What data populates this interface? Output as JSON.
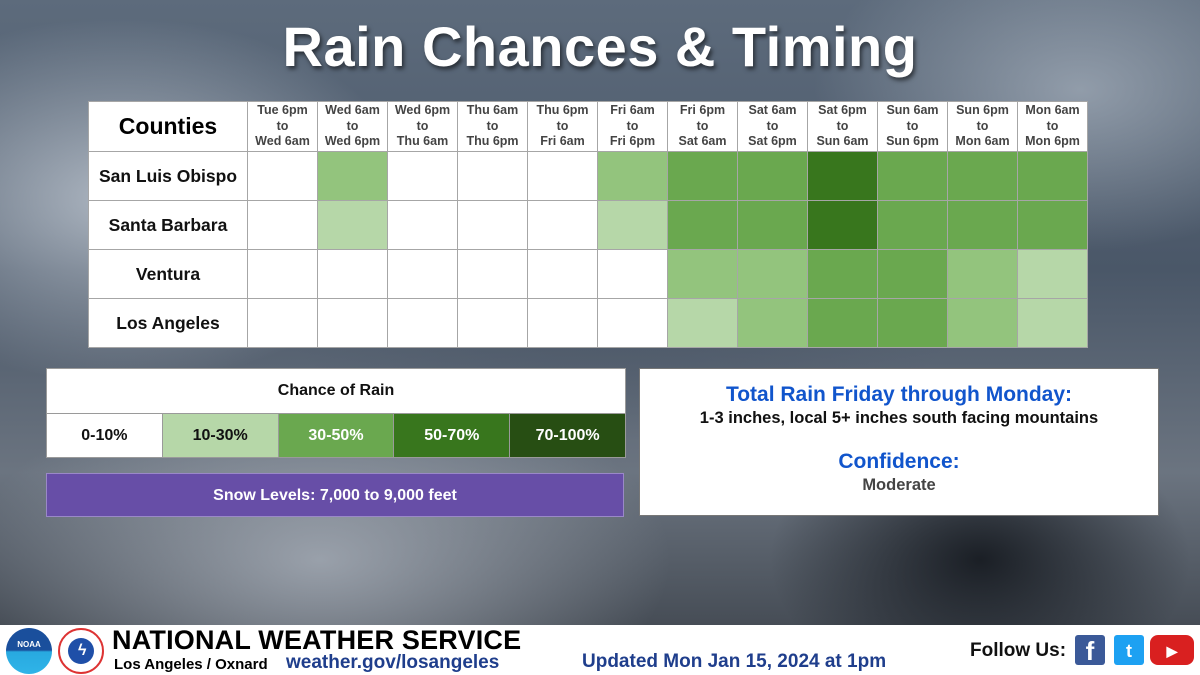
{
  "title": "Rain Chances & Timing",
  "grid": {
    "corner_label": "Counties",
    "periods": [
      {
        "l1": "Tue 6pm",
        "l2": "to",
        "l3": "Wed 6am"
      },
      {
        "l1": "Wed 6am",
        "l2": "to",
        "l3": "Wed 6pm"
      },
      {
        "l1": "Wed 6pm",
        "l2": "to",
        "l3": "Thu 6am"
      },
      {
        "l1": "Thu 6am",
        "l2": "to",
        "l3": "Thu 6pm"
      },
      {
        "l1": "Thu 6pm",
        "l2": "to",
        "l3": "Fri 6am"
      },
      {
        "l1": "Fri 6am",
        "l2": "to",
        "l3": "Fri 6pm"
      },
      {
        "l1": "Fri 6pm",
        "l2": "to",
        "l3": "Sat 6am"
      },
      {
        "l1": "Sat 6am",
        "l2": "to",
        "l3": "Sat 6pm"
      },
      {
        "l1": "Sat 6pm",
        "l2": "to",
        "l3": "Sun 6am"
      },
      {
        "l1": "Sun 6am",
        "l2": "to",
        "l3": "Sun 6pm"
      },
      {
        "l1": "Sun 6pm",
        "l2": "to",
        "l3": "Mon 6am"
      },
      {
        "l1": "Mon 6am",
        "l2": "to",
        "l3": "Mon 6pm"
      }
    ],
    "level_colors": [
      "#ffffff",
      "#b6d7a8",
      "#93c47d",
      "#6aa84f",
      "#38761d"
    ],
    "rows": [
      {
        "county": "San Luis Obispo",
        "levels": [
          0,
          2,
          0,
          0,
          0,
          2,
          3,
          3,
          4,
          3,
          3,
          3
        ]
      },
      {
        "county": "Santa Barbara",
        "levels": [
          0,
          1,
          0,
          0,
          0,
          1,
          3,
          3,
          4,
          3,
          3,
          3
        ]
      },
      {
        "county": "Ventura",
        "levels": [
          0,
          0,
          0,
          0,
          0,
          0,
          2,
          2,
          3,
          3,
          2,
          1
        ]
      },
      {
        "county": "Los Angeles",
        "levels": [
          0,
          0,
          0,
          0,
          0,
          0,
          1,
          2,
          3,
          3,
          2,
          1
        ]
      }
    ]
  },
  "legend": {
    "title": "Chance of Rain",
    "items": [
      {
        "label": "0-10%",
        "color": "#ffffff",
        "text_color": "#111111"
      },
      {
        "label": "10-30%",
        "color": "#b6d7a8",
        "text_color": "#111111"
      },
      {
        "label": "30-50%",
        "color": "#6aa84f",
        "text_color": "#ffffff"
      },
      {
        "label": "50-70%",
        "color": "#38761d",
        "text_color": "#ffffff"
      },
      {
        "label": "70-100%",
        "color": "#274e13",
        "text_color": "#ffffff"
      }
    ]
  },
  "snow_levels": "Snow Levels: 7,000 to 9,000 feet",
  "info": {
    "total_heading": "Total Rain Friday through Monday:",
    "total_value": "1-3 inches, local 5+ inches south facing mountains",
    "confidence_heading": "Confidence:",
    "confidence_value": "Moderate"
  },
  "footer": {
    "noaa_logo": "NOAA",
    "org_name": "NATIONAL WEATHER SERVICE",
    "office": "Los Angeles / Oxnard",
    "url": "weather.gov/losangeles",
    "updated": "Updated Mon Jan 15, 2024 at 1pm",
    "follow_label": "Follow Us:",
    "social": [
      {
        "name": "facebook",
        "glyph": "f"
      },
      {
        "name": "twitter",
        "glyph": "t"
      },
      {
        "name": "youtube",
        "glyph": "▶"
      }
    ]
  }
}
